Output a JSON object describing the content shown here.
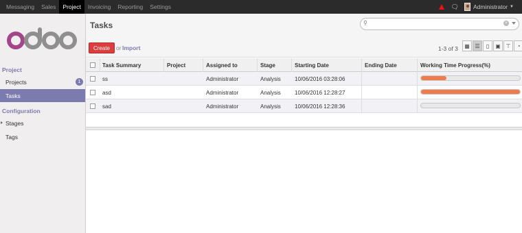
{
  "top_menu": [
    {
      "label": "Messaging",
      "active": false
    },
    {
      "label": "Sales",
      "active": false
    },
    {
      "label": "Project",
      "active": true
    },
    {
      "label": "Invoicing",
      "active": false
    },
    {
      "label": "Reporting",
      "active": false
    },
    {
      "label": "Settings",
      "active": false
    }
  ],
  "user": {
    "name": "Administrator"
  },
  "sidebar": {
    "logo_text": "odoo",
    "section_project": "Project",
    "items_project": [
      {
        "label": "Projects",
        "badge": "1",
        "active": false
      },
      {
        "label": "Tasks",
        "active": true
      }
    ],
    "section_config": "Configuration",
    "items_config": [
      {
        "label": "Stages",
        "expandable": true
      },
      {
        "label": "Tags",
        "expandable": false
      }
    ]
  },
  "main": {
    "title": "Tasks",
    "search": {
      "placeholder": ""
    },
    "create_label": "Create",
    "or_label": "or",
    "import_label": "Import",
    "pager": "1-3 of 3",
    "view_icons": [
      "kanban-icon",
      "list-icon",
      "form-icon",
      "calendar-icon",
      "gantt-icon",
      "graph-icon"
    ]
  },
  "table": {
    "headers": [
      "Task Summary",
      "Project",
      "Assigned to",
      "Stage",
      "Starting Date",
      "Ending Date",
      "Working Time Progress(%)"
    ],
    "rows": [
      {
        "summary": "ss",
        "project": "",
        "assigned": "Administrator",
        "stage": "Analysis",
        "start": "10/06/2016 03:28:06",
        "end": "",
        "progress": 0.26
      },
      {
        "summary": "asd",
        "project": "",
        "assigned": "Administrator",
        "stage": "Analysis",
        "start": "10/06/2016 12:28:27",
        "end": "",
        "progress": 1.0
      },
      {
        "summary": "sad",
        "project": "",
        "assigned": "Administrator",
        "stage": "Analysis",
        "start": "10/06/2016 12:28:36",
        "end": "",
        "progress": 0.0
      }
    ]
  },
  "colors": {
    "accent": "#7c7bad",
    "create": "#dc3d3d",
    "progress": "#ef7b4d",
    "topbar": "#2b2b2b"
  }
}
